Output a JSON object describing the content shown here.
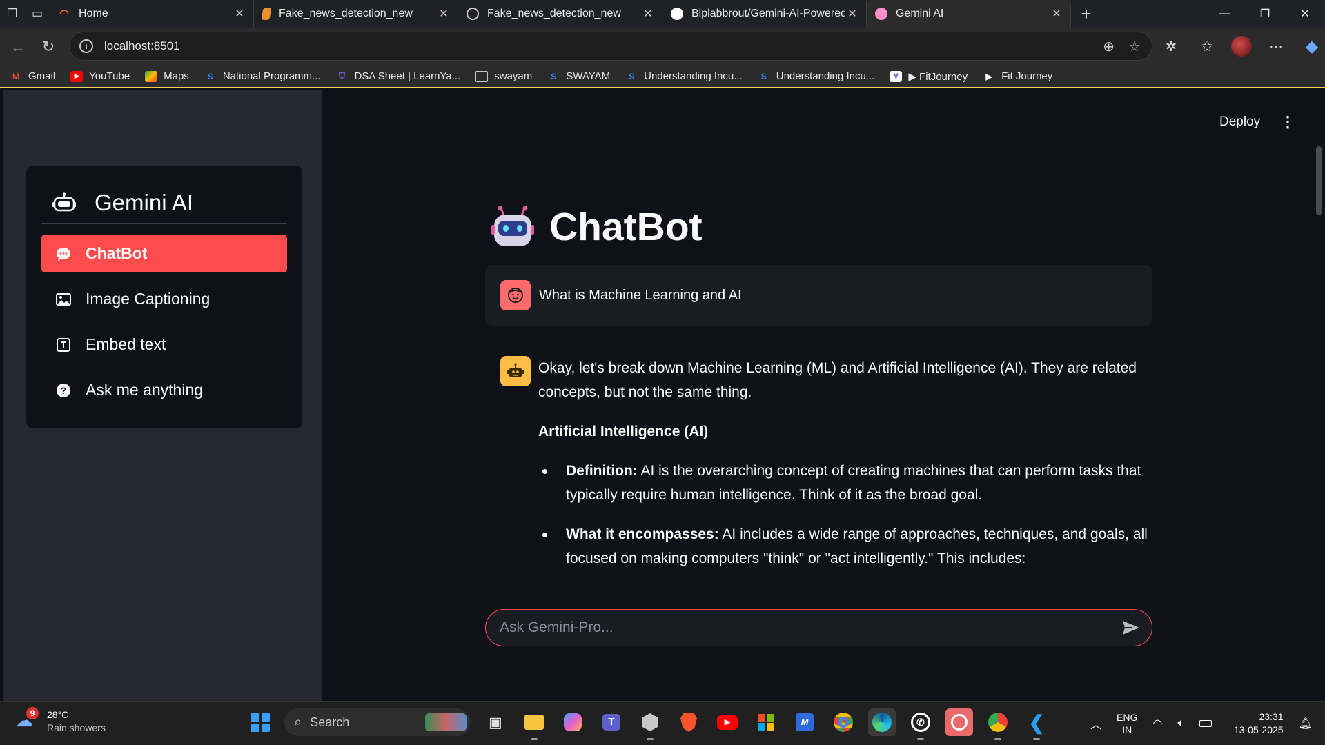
{
  "browser": {
    "tabs": [
      {
        "title": "Home",
        "favicon": "refresh-orange-icon",
        "color": "#f26b1d"
      },
      {
        "title": "Fake_news_detection_new",
        "favicon": "book-orange-icon",
        "color": "#e8912d"
      },
      {
        "title": "Fake_news_detection_new",
        "favicon": "globe-icon",
        "color": "#c8c8c8"
      },
      {
        "title": "Biplabbrout/Gemini-AI-Powered-I",
        "favicon": "github-icon",
        "color": "#ffffff"
      },
      {
        "title": "Gemini AI",
        "favicon": "streamlit-icon",
        "color": "#ff8fc4"
      }
    ],
    "active_tab_index": 4,
    "url": "localhost:8501",
    "bookmarks": [
      {
        "label": "Gmail",
        "icon": "gmail-icon",
        "color": "#ea4335"
      },
      {
        "label": "YouTube",
        "icon": "youtube-icon",
        "color": "#ff0000"
      },
      {
        "label": "Maps",
        "icon": "maps-icon",
        "color": "#34a853"
      },
      {
        "label": "National Programm...",
        "icon": "swayam-icon",
        "color": "#2f80ed"
      },
      {
        "label": "DSA Sheet | LearnYa...",
        "icon": "shield-icon",
        "color": "#8b5cf6"
      },
      {
        "label": "swayam",
        "icon": "folder-icon",
        "color": "#c8c8c8"
      },
      {
        "label": "SWAYAM",
        "icon": "swayam-icon",
        "color": "#2f80ed"
      },
      {
        "label": "Understanding Incu...",
        "icon": "swayam-icon",
        "color": "#2f80ed"
      },
      {
        "label": "Understanding Incu...",
        "icon": "swayam-icon",
        "color": "#2f80ed"
      },
      {
        "label": "▶ FitJourney",
        "icon": "yahoo-icon",
        "color": "#6f3cf5"
      },
      {
        "label": "Fit Journey",
        "icon": "play-icon",
        "color": "#ffffff"
      }
    ]
  },
  "app": {
    "sidebar": {
      "brand": "Gemini AI",
      "menu": [
        {
          "label": "ChatBot",
          "icon": "chat-bubble-icon",
          "active": true
        },
        {
          "label": "Image Captioning",
          "icon": "image-icon",
          "active": false
        },
        {
          "label": "Embed text",
          "icon": "text-box-icon",
          "active": false
        },
        {
          "label": "Ask me anything",
          "icon": "question-circle-icon",
          "active": false
        }
      ]
    },
    "header": {
      "deploy": "Deploy",
      "menu_icon": "⋮"
    },
    "title": "ChatBot",
    "title_icon": "robot-face-icon",
    "messages": {
      "user": "What is Machine Learning and AI",
      "assistant": {
        "intro": "Okay, let's break down Machine Learning (ML) and Artificial Intelligence (AI). They are related concepts, but not the same thing.",
        "heading": "Artificial Intelligence (AI)",
        "bullets": [
          {
            "term": "Definition:",
            "text": " AI is the overarching concept of creating machines that can perform tasks that typically require human intelligence. Think of it as the broad goal."
          },
          {
            "term": "What it encompasses:",
            "text": " AI includes a wide range of approaches, techniques, and goals, all focused on making computers \"think\" or \"act intelligently.\" This includes:"
          }
        ]
      }
    },
    "input": {
      "placeholder": "Ask Gemini-Pro..."
    },
    "accent": "#ff4b4b"
  },
  "taskbar": {
    "weather": {
      "temp": "28°C",
      "condition": "Rain showers",
      "badge": "9"
    },
    "search_label": "Search",
    "apps": [
      "task-view-icon",
      "file-explorer-icon",
      "copilot-icon",
      "teams-icon",
      "obs-icon",
      "brave-icon",
      "youtube-icon",
      "store-icon",
      "code-editor-icon",
      "chrome-icon",
      "edge-icon",
      "whatsapp-icon",
      "snipping-tool-icon",
      "chrome-profile-icon",
      "vscode-icon"
    ],
    "lang_top": "ENG",
    "lang_bottom": "IN",
    "time": "23:31",
    "date": "13-05-2025"
  }
}
